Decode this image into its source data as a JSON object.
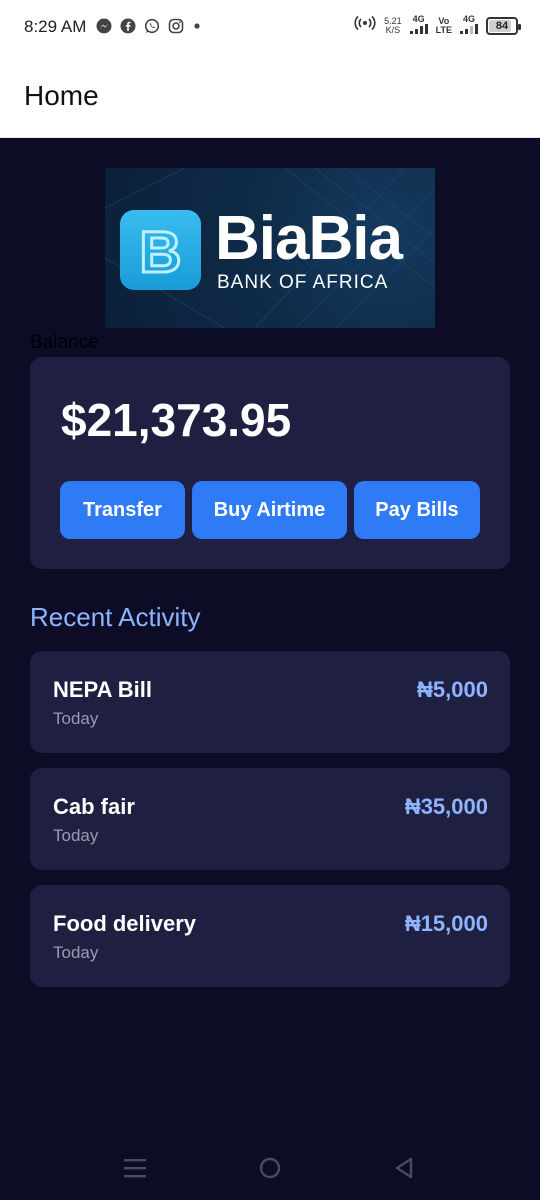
{
  "status_bar": {
    "time": "8:29 AM",
    "app_icons": [
      "messenger-icon",
      "facebook-icon",
      "whatsapp-icon",
      "instagram-icon"
    ],
    "speed_value": "5.21",
    "speed_unit": "K/S",
    "net1": "4G",
    "volte_top": "Vo",
    "volte_bottom": "LTE",
    "net2": "4G",
    "battery": "84"
  },
  "app_bar": {
    "title": "Home"
  },
  "logo": {
    "brand": "BiaBia",
    "subtitle": "BANK OF AFRICA",
    "mark_letter": "B"
  },
  "balance": {
    "label": "Balance",
    "amount": "$21,373.95",
    "actions": [
      "Transfer",
      "Buy Airtime",
      "Pay Bills"
    ]
  },
  "recent": {
    "title": "Recent Activity",
    "items": [
      {
        "title": "NEPA Bill",
        "date": "Today",
        "amount": "₦5,000"
      },
      {
        "title": "Cab fair",
        "date": "Today",
        "amount": "₦35,000"
      },
      {
        "title": "Food delivery",
        "date": "Today",
        "amount": "₦15,000"
      }
    ]
  },
  "colors": {
    "background": "#0c0c26",
    "card": "#1f1f41",
    "accent": "#2f7bf6",
    "amount": "#8fb4ff"
  }
}
